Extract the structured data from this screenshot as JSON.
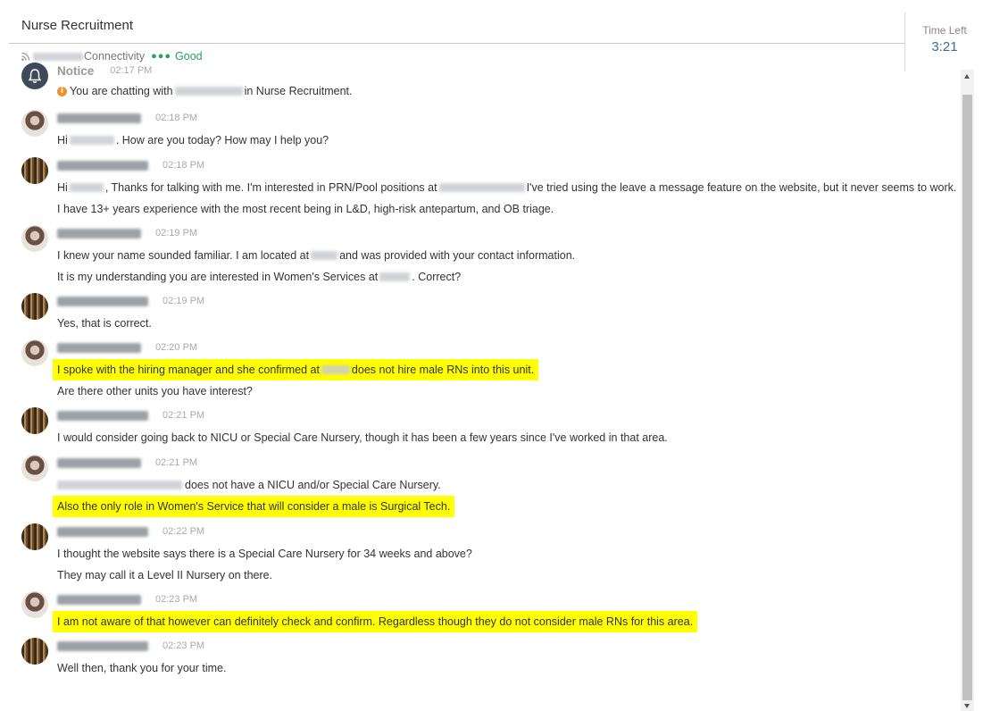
{
  "header": {
    "title": "Nurse Recruitment"
  },
  "timer": {
    "label": "Time Left",
    "value": "3:21"
  },
  "connectivity": {
    "label": "Connectivity",
    "status": "Good",
    "indicator": "●●●",
    "status_color": "#27a35a"
  },
  "notice": {
    "sender": "Notice",
    "time": "02:17 PM",
    "prefix": "You are chatting with",
    "suffix": "in Nurse Recruitment."
  },
  "messages": [
    {
      "time": "02:18 PM",
      "lines": [
        {
          "pre": "Hi",
          "post": ". How are you today? How may I help you?"
        }
      ]
    },
    {
      "time": "02:18 PM",
      "lines": [
        {
          "pre": "Hi",
          "mid": ", Thanks for talking with me. I'm interested in PRN/Pool positions at",
          "post": " I've tried using the leave a message feature on the website, but it never seems to work."
        },
        {
          "text": "I have 13+ years experience with the most recent being in L&D, high-risk antepartum, and OB triage."
        }
      ]
    },
    {
      "time": "02:19 PM",
      "lines": [
        {
          "pre": "I knew your name sounded familiar. I am located at",
          "post": "and was provided with your contact information."
        },
        {
          "pre": "It is my understanding you are interested in Women's Services at",
          "post": ". Correct?"
        }
      ]
    },
    {
      "time": "02:19 PM",
      "lines": [
        {
          "text": "Yes, that is correct."
        }
      ]
    },
    {
      "time": "02:20 PM",
      "lines": [
        {
          "pre": "I spoke with the hiring manager and she confirmed at",
          "post": "does not hire male RNs into this unit."
        },
        {
          "text": "Are there other units you have interest?"
        }
      ]
    },
    {
      "time": "02:21 PM",
      "lines": [
        {
          "text": "I would consider going back to NICU or Special Care Nursery, though it has been a few years since I've worked in that area."
        }
      ]
    },
    {
      "time": "02:21 PM",
      "lines": [
        {
          "post": "does not have a NICU and/or Special Care Nursery."
        },
        {
          "text": "Also the only role in Women's Service that will consider a male is Surgical Tech."
        }
      ]
    },
    {
      "time": "02:22 PM",
      "lines": [
        {
          "text": "I thought the website says there is a Special Care Nursery for 34 weeks and above?"
        },
        {
          "text": "They may call it a Level II Nursery on there."
        }
      ]
    },
    {
      "time": "02:23 PM",
      "lines": [
        {
          "text": "I am not aware of that however can definitely check and confirm. Regardless though they do not consider male RNs for this area."
        }
      ]
    },
    {
      "time": "02:23 PM",
      "lines": [
        {
          "text": "Well then, thank you for your time."
        }
      ]
    }
  ],
  "highlight_color": "#ffff00"
}
